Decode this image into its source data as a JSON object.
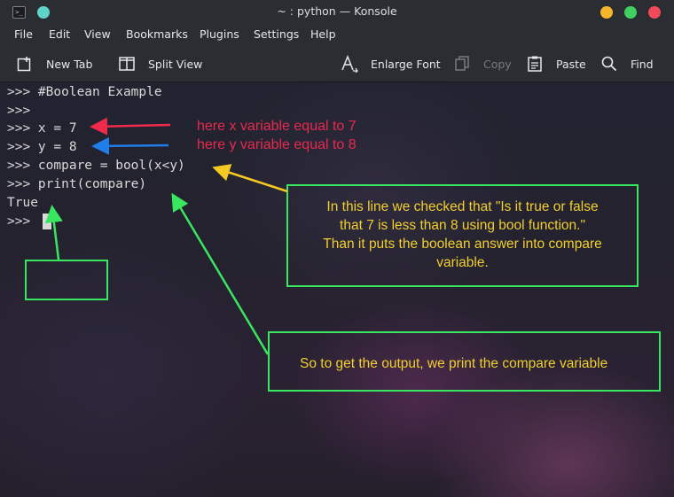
{
  "window": {
    "title": "~ : python — Konsole"
  },
  "menu": {
    "items": [
      "File",
      "Edit",
      "View",
      "Bookmarks",
      "Plugins",
      "Settings",
      "Help"
    ]
  },
  "toolbar": {
    "new_tab": "New Tab",
    "split_view": "Split View",
    "enlarge_font": "Enlarge Font",
    "copy": "Copy",
    "paste": "Paste",
    "find": "Find"
  },
  "terminal": {
    "lines": [
      ">>> #Boolean Example",
      ">>>",
      ">>> x = 7",
      ">>> y = 8",
      ">>> compare = bool(x<y)",
      ">>> print(compare)",
      "True",
      ">>>"
    ]
  },
  "annotations": {
    "x_note": "here x variable  equal to 7",
    "y_note": "here y variable equal to 8",
    "compare_note": [
      "In this line we checked that \"Is it true or false",
      "that 7 is less than 8 using bool function.\"",
      "Than it puts the boolean answer into compare",
      "variable."
    ],
    "print_note": "So to get the output, we print the compare variable"
  },
  "colors": {
    "chrome": "#2a2e32",
    "annotation_text": "#f1cf2e",
    "box_border": "#39e65f",
    "red_arrow": "#ef2a4a",
    "blue_arrow": "#1f7ee8",
    "yellow_arrow": "#f5c823",
    "green_arrow": "#39e65f",
    "red_note": "#e8294e"
  },
  "icons": {
    "app": "terminal-icon",
    "new_tab": "new-tab-icon",
    "split_view": "split-view-icon",
    "enlarge_font": "enlarge-font-icon",
    "copy": "copy-icon",
    "paste": "paste-icon",
    "find": "search-icon"
  }
}
